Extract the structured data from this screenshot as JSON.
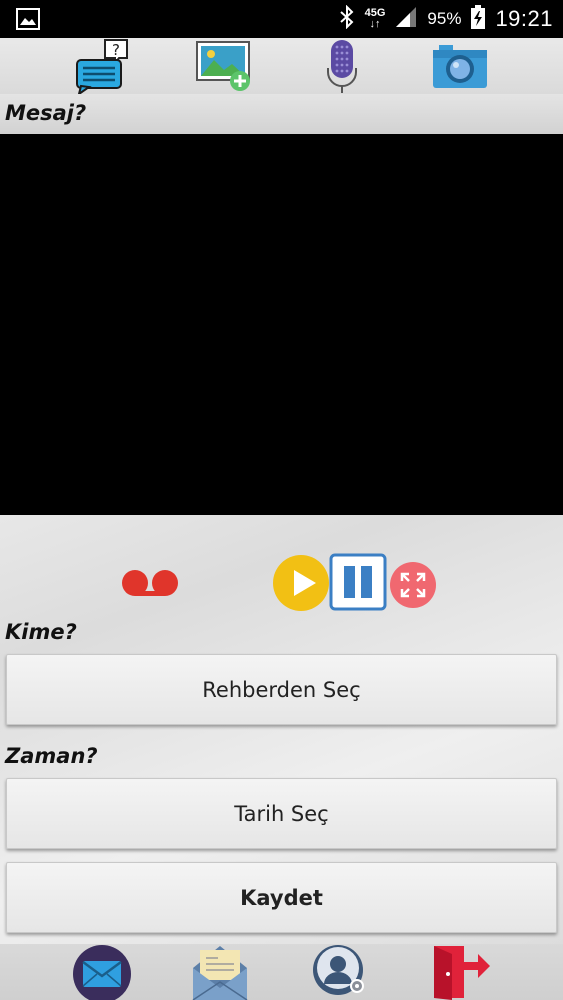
{
  "status_bar": {
    "network_label": "4.5G",
    "network_top": "45G",
    "network_bottom": "↓↑",
    "battery_percent": "95%",
    "time": "19:21"
  },
  "toolbar": {
    "icons": [
      "help-chat-icon",
      "add-image-icon",
      "microphone-icon",
      "camera-icon"
    ]
  },
  "labels": {
    "message": "Mesaj?",
    "recipient": "Kime?",
    "time": "Zaman?"
  },
  "media_controls": {
    "icons": [
      "voicemail-icon",
      "play-icon",
      "pause-icon",
      "fullscreen-icon"
    ]
  },
  "buttons": {
    "choose_contact": "Rehberden Seç",
    "choose_date": "Tarih Seç",
    "save": "Kaydet"
  },
  "bottom_nav": {
    "icons": [
      "mail-icon",
      "open-letter-icon",
      "contact-settings-icon",
      "exit-icon"
    ]
  },
  "colors": {
    "play": "#f2c014",
    "pause": "#3b7fc4",
    "fullscreen": "#f06870",
    "voicemail": "#e0352b",
    "exit": "#e0223a"
  }
}
